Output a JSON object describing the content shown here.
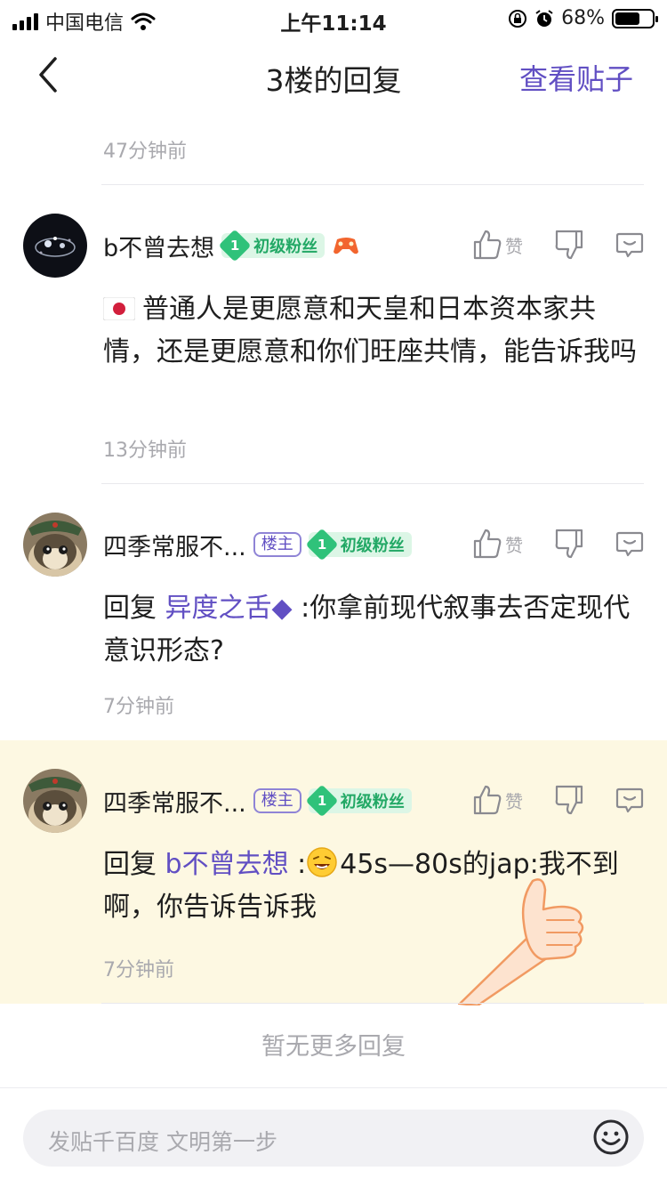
{
  "status_bar": {
    "carrier": "中国电信",
    "time": "上午11:14",
    "battery": "68%",
    "battery_level": 0.68
  },
  "header": {
    "title": "3楼的回复",
    "view_post": "查看贴子"
  },
  "top_timestamp": "47分钟前",
  "like_label": "赞",
  "replies": [
    {
      "username": "b不曾去想",
      "is_host": false,
      "fan_level": "1",
      "fan_badge": "初级粉丝",
      "content_prefix": "",
      "mention": "",
      "content": "普通人是更愿意和天皇和日本资本家共情，还是更愿意和你们旺座共情，能告诉我吗",
      "timestamp": "13分钟前"
    },
    {
      "username": "四季常服不...",
      "is_host": true,
      "host_label": "楼主",
      "fan_level": "1",
      "fan_badge": "初级粉丝",
      "content_prefix": "回复 ",
      "mention": "异度之舌◆",
      "content": " :你拿前现代叙事去否定现代意识形态?",
      "timestamp": "7分钟前"
    },
    {
      "username": "四季常服不...",
      "is_host": true,
      "host_label": "楼主",
      "fan_level": "1",
      "fan_badge": "初级粉丝",
      "content_prefix": "回复 ",
      "mention": "b不曾去想",
      "content": "45s—80s的jap:我不到啊，你告诉告诉我",
      "timestamp": "7分钟前"
    }
  ],
  "no_more": "暂无更多回复",
  "input": {
    "placeholder": "发贴千百度 文明第一步"
  },
  "colors": {
    "accent": "#614fc3",
    "highlight_bg": "#fdf8e2",
    "badge_green": "#2fc27a"
  }
}
